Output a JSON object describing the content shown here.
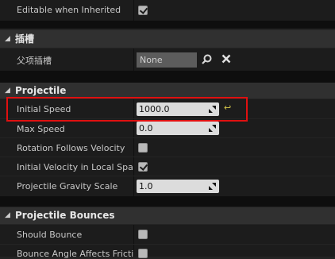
{
  "rows": {
    "editable_inherited": {
      "label": "Editable when Inherited",
      "checked": true
    }
  },
  "section_slots": {
    "title": "插槽"
  },
  "parent_slot": {
    "label": "父项插槽",
    "value": "None"
  },
  "section_projectile": {
    "title": "Projectile"
  },
  "initial_speed": {
    "label": "Initial Speed",
    "value": "1000.0"
  },
  "max_speed": {
    "label": "Max Speed",
    "value": "0.0"
  },
  "rotation_follows_velocity": {
    "label": "Rotation Follows Velocity",
    "checked": false
  },
  "initial_velocity_local": {
    "label": "Initial Velocity in Local Space",
    "checked": true
  },
  "gravity_scale": {
    "label": "Projectile Gravity Scale",
    "value": "1.0"
  },
  "section_bounces": {
    "title": "Projectile Bounces"
  },
  "should_bounce": {
    "label": "Should Bounce",
    "checked": false
  },
  "bounce_angle": {
    "label": "Bounce Angle Affects Friction",
    "checked": false
  },
  "icons": {
    "collapse": "triangle-down",
    "browse": "magnifier-icon",
    "clear": "x-icon",
    "reset": "reset-arrow-icon"
  },
  "colors": {
    "highlight": "#e01010",
    "reset": "#d4c64a"
  }
}
